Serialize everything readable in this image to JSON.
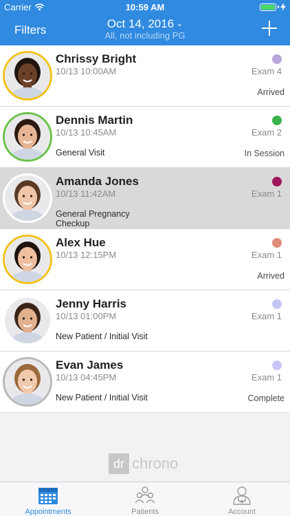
{
  "status_bar": {
    "carrier": "Carrier",
    "time": "10:59 AM",
    "battery_percent": 100
  },
  "nav": {
    "left_button": "Filters",
    "title": "Oct 14, 2016",
    "subtitle": "All, not including PG",
    "add_icon": "plus-icon"
  },
  "appointments": [
    {
      "name": "Chrissy Bright",
      "time": "10/13 10:00AM",
      "reason": "",
      "room": "Exam 4",
      "status": "Arrived",
      "dot_color": "#b7a6d8",
      "ring_color": "#f2c21b",
      "skin": "#6b4128",
      "hair": "#1f130d"
    },
    {
      "name": "Dennis Martin",
      "time": "10/13 10:45AM",
      "reason": "General Visit",
      "room": "Exam 2",
      "status": "In Session",
      "dot_color": "#3bb34a",
      "ring_color": "#6cc24a",
      "skin": "#e7b596",
      "hair": "#2b1a12"
    },
    {
      "name": "Amanda Jones",
      "time": "10/13 11:42AM",
      "reason": "General Pregnancy Checkup",
      "room": "Exam 1",
      "status": "",
      "dot_color": "#a0185a",
      "ring_color": "#ffffff",
      "skin": "#f0c6aa",
      "hair": "#5a3a25"
    },
    {
      "name": "Alex Hue",
      "time": "10/13 12:15PM",
      "reason": "",
      "room": "Exam 1",
      "status": "Arrived",
      "dot_color": "#e08a7a",
      "ring_color": "#f2c21b",
      "skin": "#eec09f",
      "hair": "#1e140e"
    },
    {
      "name": "Jenny Harris",
      "time": "10/13 01:00PM",
      "reason": "New Patient / Initial Visit",
      "room": "Exam 1",
      "status": "",
      "dot_color": "#c5c6f6",
      "ring_color": "#ffffff",
      "skin": "#e1b08f",
      "hair": "#3a2418"
    },
    {
      "name": "Evan James",
      "time": "10/13 04:45PM",
      "reason": "New Patient / Initial Visit",
      "room": "Exam 1",
      "status": "Complete",
      "dot_color": "#c5c6f6",
      "ring_color": "#b9b9b9",
      "skin": "#f1c9ad",
      "hair": "#9a6a3a"
    }
  ],
  "logo": {
    "prefix": "dr",
    "word": "chrono"
  },
  "tabs": [
    {
      "label": "Appointments",
      "icon": "calendar-icon",
      "active": true
    },
    {
      "label": "Patients",
      "icon": "patients-icon",
      "active": false
    },
    {
      "label": "Account",
      "icon": "account-icon",
      "active": false
    }
  ]
}
